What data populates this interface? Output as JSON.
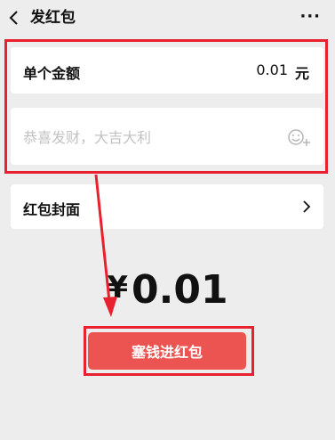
{
  "header": {
    "title": "发红包",
    "more": "···"
  },
  "amount": {
    "label": "单个金额",
    "value": "0.01",
    "unit": "元"
  },
  "message": {
    "placeholder": "恭喜发财，大吉大利",
    "value": ""
  },
  "cover": {
    "label": "红包封面"
  },
  "total": {
    "currency": "¥",
    "value": "0.01"
  },
  "send_button": {
    "label": "塞钱进红包"
  },
  "colors": {
    "highlight": "#e8202f",
    "button": "#ec5451",
    "background": "#ededed"
  },
  "icons": [
    "back-arrow-icon",
    "more-icon",
    "emoji-add-icon",
    "chevron-right-icon"
  ]
}
